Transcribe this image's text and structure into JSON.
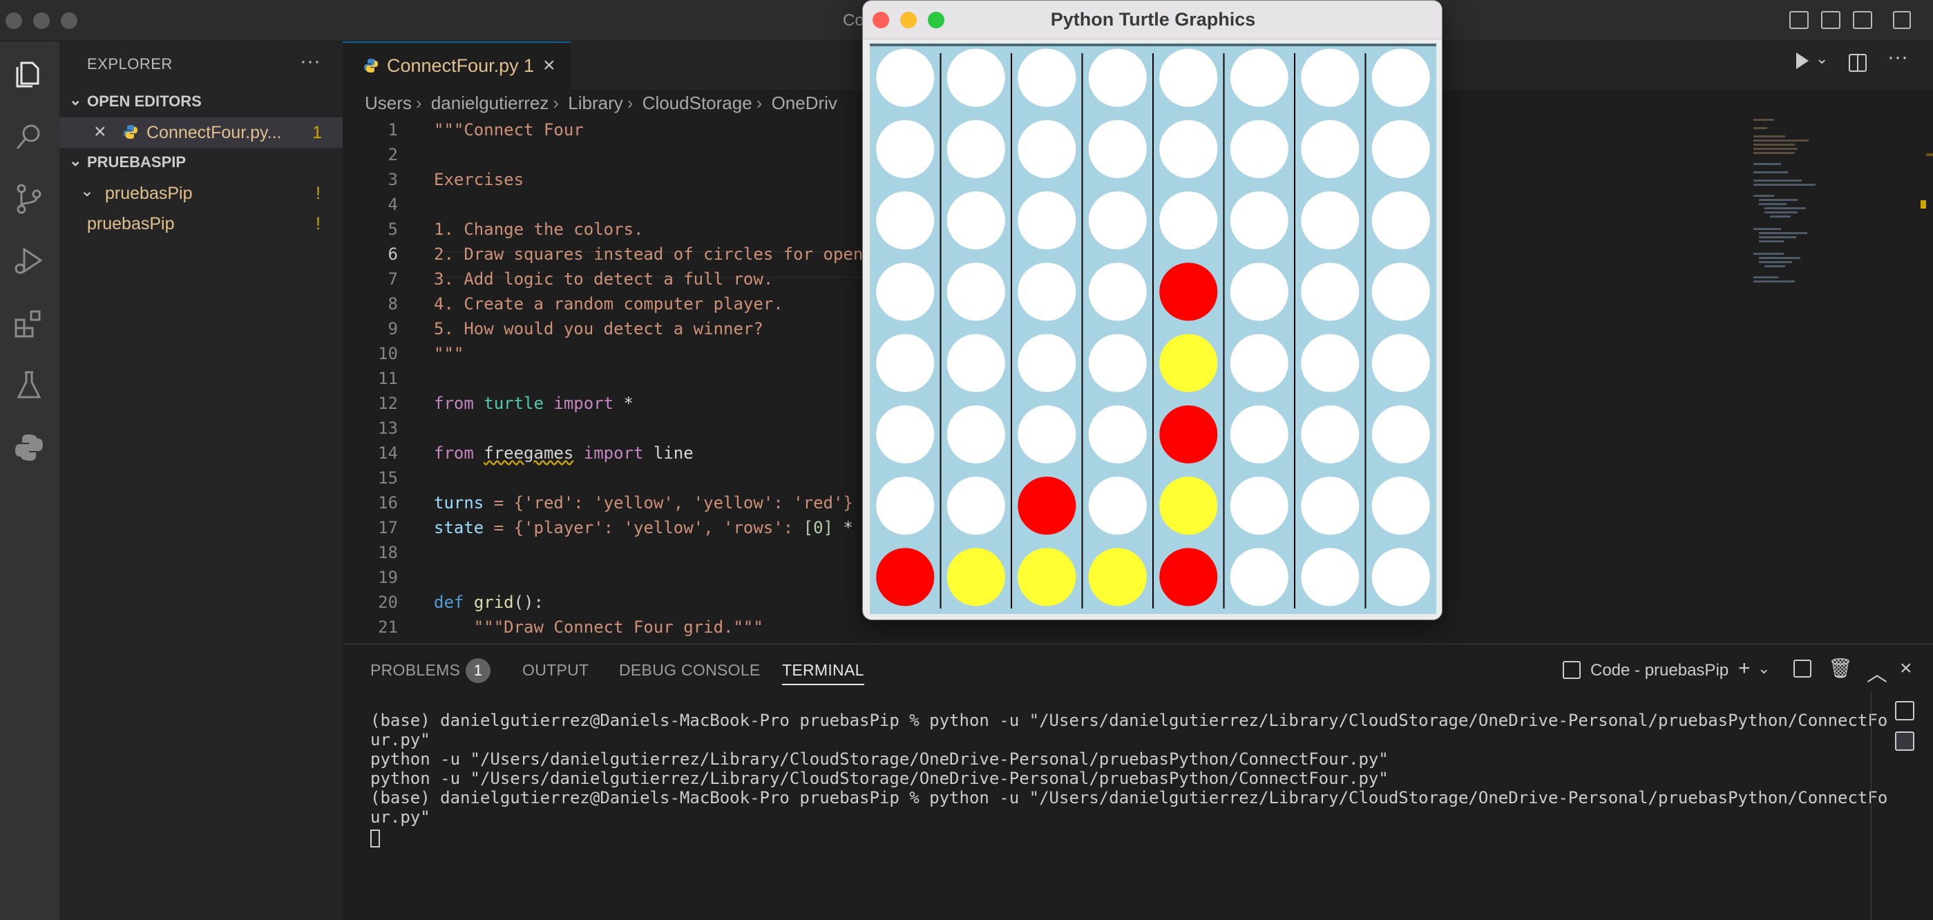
{
  "window": {
    "title": "Co"
  },
  "sidebar": {
    "header": "EXPLORER",
    "more": "···",
    "open_editors_title": "OPEN EDITORS",
    "open_editor": {
      "name": "ConnectFour.py...",
      "count": "1"
    },
    "workspace_title": "PRUEBASPIP",
    "items": [
      {
        "label": "pruebasPip",
        "mod": "!"
      },
      {
        "label": "pruebasPip",
        "mod": "!"
      }
    ]
  },
  "tab": {
    "label": "ConnectFour.py",
    "count": "1"
  },
  "breadcrumb": [
    "Users",
    "danielgutierrez",
    "Library",
    "CloudStorage",
    "OneDriv"
  ],
  "code": {
    "line_numbers": [
      "1",
      "2",
      "3",
      "4",
      "5",
      "6",
      "7",
      "8",
      "9",
      "10",
      "11",
      "12",
      "13",
      "14",
      "15",
      "16",
      "17",
      "18",
      "19",
      "20",
      "21"
    ],
    "l1": "\"\"\"Connect Four",
    "l3": "Exercises",
    "l5": "1. Change the colors.",
    "l6": "2. Draw squares instead of circles for open",
    "l7": "3. Add logic to detect a full row.",
    "l8": "4. Create a random computer player.",
    "l9": "5. How would you detect a winner?",
    "l10": "\"\"\"",
    "l12": {
      "kw1": "from",
      "mod": "turtle",
      "kw2": "import",
      "rest": " *"
    },
    "l14": {
      "kw1": "from",
      "mod": "freegames",
      "kw2": "import",
      "rest": " line"
    },
    "l16": {
      "var": "turns",
      "rest": " = {'red': 'yellow', 'yellow': 'red'}"
    },
    "l17": {
      "var": "state",
      "rest1": " = {'player': 'yellow', 'rows': ",
      "num": "[0]",
      "rest2": " *"
    },
    "l20": {
      "def": "def",
      "fn": "grid",
      "rest": "():"
    },
    "l21": "    \"\"\"Draw Connect Four grid.\"\"\""
  },
  "panel": {
    "tabs": [
      "PROBLEMS",
      "OUTPUT",
      "DEBUG CONSOLE",
      "TERMINAL"
    ],
    "problems_count": "1",
    "terminal_name": "Code - pruebasPip",
    "lines": [
      "(base) danielgutierrez@Daniels-MacBook-Pro pruebasPip % python -u \"/Users/danielgutierrez/Library/CloudStorage/OneDrive-Personal/pruebasPython/ConnectFo",
      "ur.py\"",
      "python -u \"/Users/danielgutierrez/Library/CloudStorage/OneDrive-Personal/pruebasPython/ConnectFour.py\"",
      "python -u \"/Users/danielgutierrez/Library/CloudStorage/OneDrive-Personal/pruebasPython/ConnectFour.py\"",
      "(base) danielgutierrez@Daniels-MacBook-Pro pruebasPip % python -u \"/Users/danielgutierrez/Library/CloudStorage/OneDrive-Personal/pruebasPython/ConnectFo",
      "ur.py\""
    ]
  },
  "turtle": {
    "title": "Python Turtle Graphics",
    "board_color": "#a8d3e3",
    "columns": 8,
    "rows": 8,
    "grid": [
      [
        "W",
        "W",
        "W",
        "W",
        "W",
        "W",
        "W",
        "W"
      ],
      [
        "W",
        "W",
        "W",
        "W",
        "W",
        "W",
        "W",
        "W"
      ],
      [
        "W",
        "W",
        "W",
        "W",
        "W",
        "W",
        "W",
        "W"
      ],
      [
        "W",
        "W",
        "W",
        "W",
        "R",
        "W",
        "W",
        "W"
      ],
      [
        "W",
        "W",
        "W",
        "W",
        "Y",
        "W",
        "W",
        "W"
      ],
      [
        "W",
        "W",
        "W",
        "W",
        "R",
        "W",
        "W",
        "W"
      ],
      [
        "W",
        "W",
        "R",
        "W",
        "Y",
        "W",
        "W",
        "W"
      ],
      [
        "R",
        "Y",
        "Y",
        "Y",
        "R",
        "W",
        "W",
        "W"
      ]
    ],
    "colors": {
      "W": "#ffffff",
      "R": "#ff0000",
      "Y": "#ffff33"
    }
  }
}
